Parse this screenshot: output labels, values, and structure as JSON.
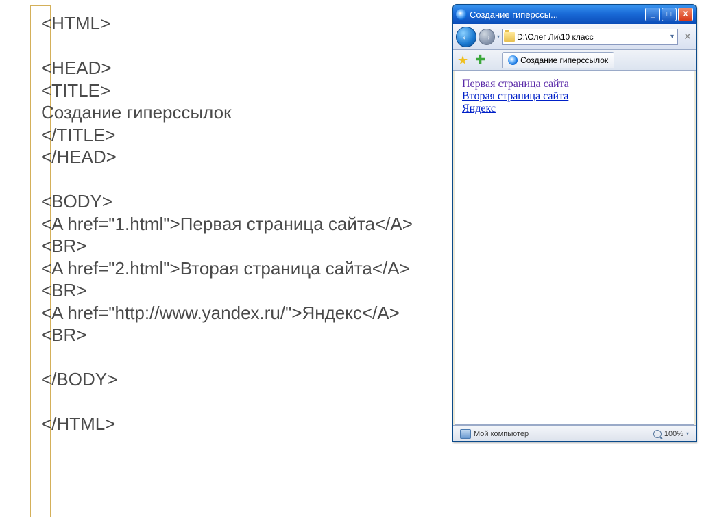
{
  "code": {
    "l1": "<HTML>",
    "l2": "",
    "l3": "<HEAD>",
    "l4": "<TITLE>",
    "l5": "Создание гиперссылок",
    "l6": "</TITLE>",
    "l7": "</HEAD>",
    "l8": "",
    "l9": "<BODY>",
    "l10": "<A href=\"1.html\">Первая страница сайта</A><BR>",
    "l11": "<A href=\"2.html\">Вторая страница сайта</A><BR>",
    "l12": "<A href=\"http://www.yandex.ru/\">Яндекс</A><BR>",
    "l13": "",
    "l14": "</BODY>",
    "l15": "",
    "l16": "</HTML>"
  },
  "browser": {
    "title": "Создание гиперссы...",
    "address_path": "D:\\Олег Ли\\10 класс",
    "tab_label": "Создание гиперссылок",
    "links": {
      "link1": "Первая страница сайта",
      "link2": "Вторая страница сайта",
      "link3": "Яндекс"
    },
    "status": {
      "computer": "Мой компьютер",
      "zoom": "100%"
    },
    "buttons": {
      "min": "_",
      "max": "□",
      "close": "X",
      "back": "←",
      "fwd": "→",
      "dd": "▾",
      "cancel": "✕"
    }
  }
}
